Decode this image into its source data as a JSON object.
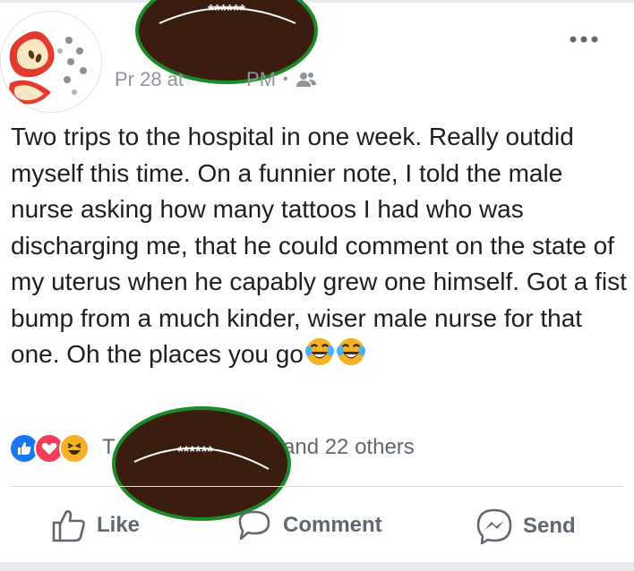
{
  "post": {
    "timestamp": "Pr 28 at",
    "timestamp_suffix": "PM",
    "audience_icon": "friends-icon",
    "text": "Two trips to the hospital in one week. Really outdid myself this time. On a funnier note, I told the male nurse asking how many tattoos I had who was discharging me, that he could comment on the state of my uterus when he capably grew one himself. Got a fist bump from a much kinder, wiser male nurse for that one. Oh the places you go",
    "emojis": [
      "laughing-crying-emoji",
      "laughing-crying-emoji"
    ]
  },
  "reactions": {
    "icons": [
      "like-reaction-icon",
      "love-reaction-icon",
      "haha-reaction-icon"
    ],
    "names_prefix": "T",
    "names_suffix": "and 22 others"
  },
  "redaction": {
    "label": "******"
  },
  "actions": {
    "like": "Like",
    "comment": "Comment",
    "send": "Send"
  },
  "colors": {
    "football_brown": "#3a1d0e",
    "football_edge": "#1d8a2a",
    "muted_text": "#606770",
    "like_blue": "#1877f2",
    "love_red": "#f33e58",
    "haha_yellow": "#f7b125"
  }
}
